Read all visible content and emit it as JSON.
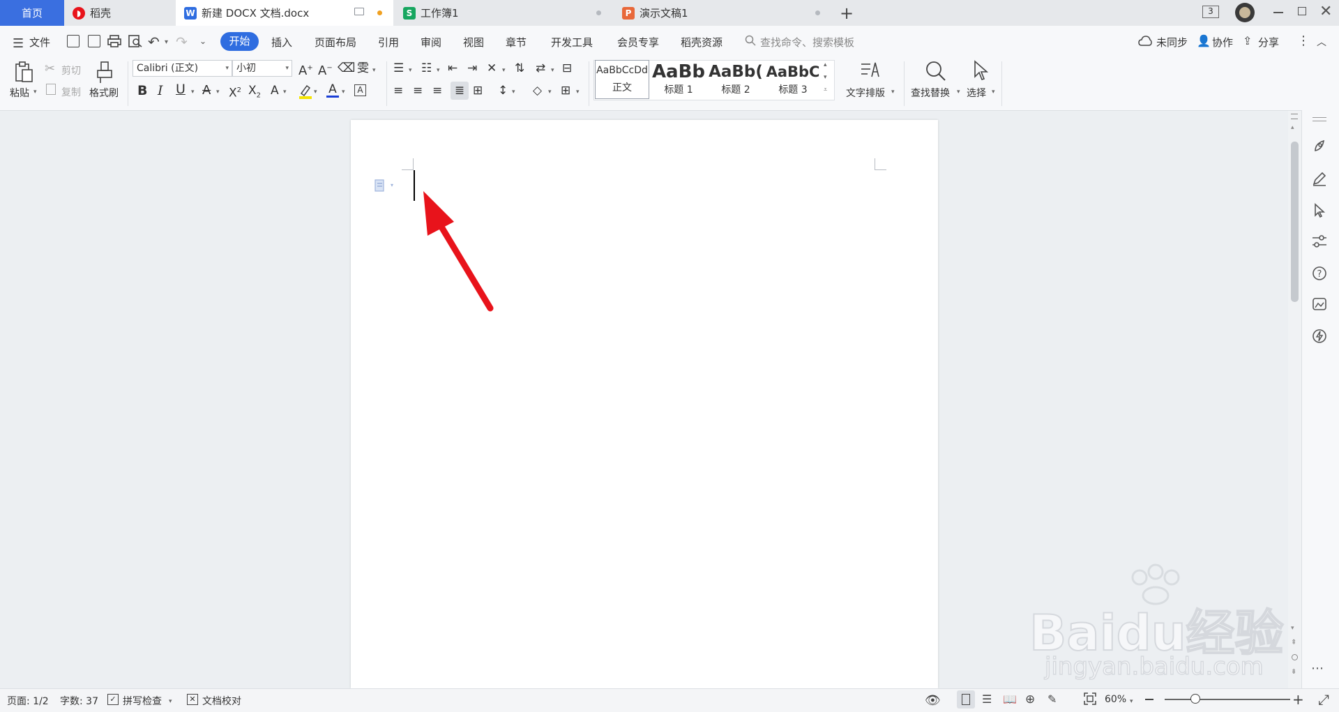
{
  "tabs": [
    {
      "label": "首页",
      "active": true
    },
    {
      "label": "稻壳"
    },
    {
      "label": "新建 DOCX 文档.docx"
    },
    {
      "label": "工作簿1"
    },
    {
      "label": "演示文稿1"
    }
  ],
  "window": {
    "badge": "3"
  },
  "menu": {
    "file": "文件",
    "items": [
      "开始",
      "插入",
      "页面布局",
      "引用",
      "审阅",
      "视图",
      "章节",
      "开发工具",
      "会员专享",
      "稻壳资源"
    ],
    "search_placeholder": "查找命令、搜索模板",
    "sync": "未同步",
    "collab": "协作",
    "share": "分享"
  },
  "ribbon": {
    "paste": "粘贴",
    "cut": "剪切",
    "copy": "复制",
    "format_painter": "格式刷",
    "font_name": "Calibri (正文)",
    "font_size": "小初",
    "styles": [
      {
        "preview": "AaBbCcDd",
        "label": "正文"
      },
      {
        "preview": "AaBb",
        "label": "标题 1"
      },
      {
        "preview": "AaBb(",
        "label": "标题 2"
      },
      {
        "preview": "AaBbC",
        "label": "标题 3"
      }
    ],
    "text_layout": "文字排版",
    "find_replace": "查找替换",
    "select": "选择"
  },
  "status": {
    "page": "页面: 1/2",
    "words": "字数: 37",
    "spell": "拼写检查",
    "proof": "文档校对",
    "zoom": "60%"
  },
  "watermark": {
    "text1": "Baidu经验",
    "text2": "jingyan.baidu.com"
  },
  "colors": {
    "accent": "#2f6de0",
    "writer": "#2f6de0",
    "sheet": "#17a660",
    "slides": "#e8683a",
    "arrow": "#e8131b"
  }
}
